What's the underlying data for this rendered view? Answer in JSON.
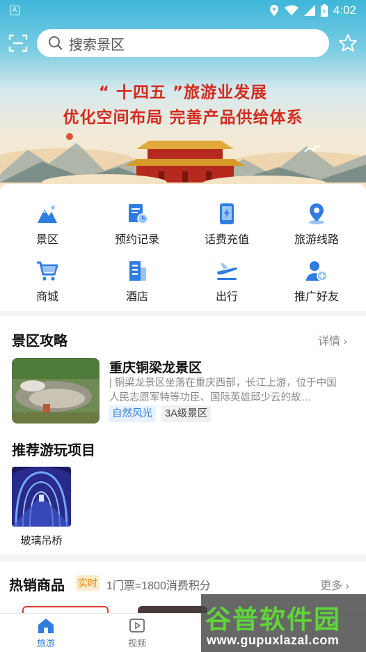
{
  "status_bar": {
    "time": "4:02",
    "left_icon": "A"
  },
  "search": {
    "placeholder": "搜索景区"
  },
  "banner": {
    "line1": "“ 十四五 ”旅游业发展",
    "line2": "优化空间布局  完善产品供给体系"
  },
  "menu": [
    {
      "label": "景区",
      "icon": "mountain-icon"
    },
    {
      "label": "预约记录",
      "icon": "booking-record-icon"
    },
    {
      "label": "话费充值",
      "icon": "phone-recharge-icon"
    },
    {
      "label": "旅游线路",
      "icon": "location-pin-icon"
    },
    {
      "label": "商城",
      "icon": "cart-icon"
    },
    {
      "label": "酒店",
      "icon": "hotel-icon"
    },
    {
      "label": "出行",
      "icon": "plane-icon"
    },
    {
      "label": "推广好友",
      "icon": "add-friend-icon"
    }
  ],
  "scenic": {
    "title": "景区攻略",
    "more": "详情 ›",
    "item": {
      "name": "重庆铜梁龙景区",
      "desc": "| 铜梁龙景区坐落在重庆西部，长江上游，位于中国人民志愿军特等功臣、国际英雄邱少云的故…",
      "tag1": "自然风光",
      "tag2": "3A级景区"
    },
    "projects_title": "推荐游玩项目",
    "project": {
      "name": "玻璃吊桥"
    }
  },
  "hot": {
    "title": "热销商品",
    "badge": "实时",
    "sub": "1门票=1800消费积分",
    "more": "更多 ›"
  },
  "tabs": [
    {
      "label": "旅游",
      "active": true
    },
    {
      "label": "视频",
      "active": false
    }
  ],
  "watermark": {
    "title": "谷普软件园",
    "url": "www.gupuxlazal.com"
  },
  "colors": {
    "accent": "#2f7de1",
    "slogan": "#d42a1e"
  }
}
